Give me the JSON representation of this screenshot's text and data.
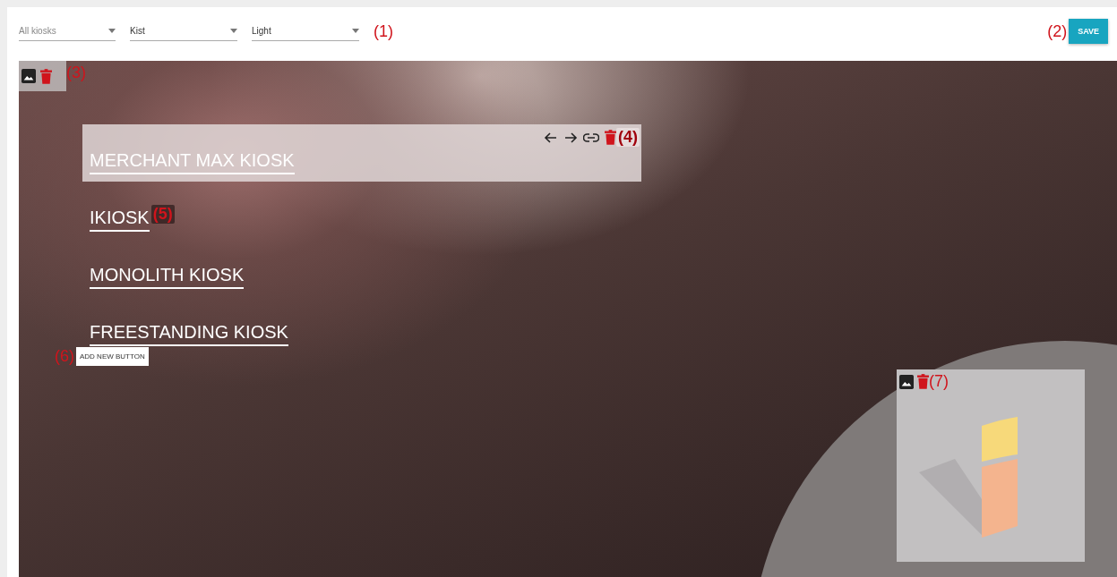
{
  "toolbar": {
    "filters": [
      {
        "value": "All kiosks",
        "muted": true
      },
      {
        "value": "Kist",
        "muted": false
      },
      {
        "value": "Light",
        "muted": false
      }
    ],
    "filters_note": "(1)",
    "save_note": "(2)",
    "save": "SAVE"
  },
  "canvas": {
    "background_note": "(3)",
    "buttons": [
      {
        "label": "MERCHANT MAX KIOSK",
        "selected": true,
        "note": "(4)"
      },
      {
        "label": "IKIOSK",
        "selected": false,
        "note": "(5)"
      },
      {
        "label": "MONOLITH KIOSK",
        "selected": false
      },
      {
        "label": "FREESTANDING KIOSK",
        "selected": false
      }
    ],
    "add_note": "(6)",
    "add_button": "ADD NEW BUTTON",
    "image_note": "(7)"
  }
}
